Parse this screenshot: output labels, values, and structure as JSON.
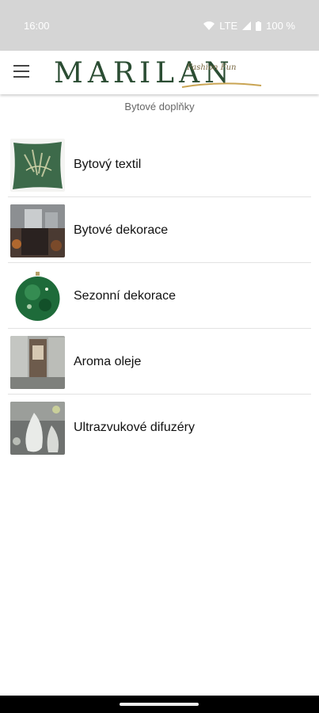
{
  "status": {
    "time": "16:00",
    "network": "LTE",
    "battery": "100 %"
  },
  "header": {
    "logo_main": "MARILAN",
    "logo_script": "Fashion Fun"
  },
  "page_title": "Bytové doplňky",
  "categories": [
    {
      "label": "Bytový textil",
      "icon": "pillow-thumbnail"
    },
    {
      "label": "Bytové dekorace",
      "icon": "decor-thumbnail"
    },
    {
      "label": "Sezonní dekorace",
      "icon": "ornament-thumbnail"
    },
    {
      "label": "Aroma oleje",
      "icon": "aroma-oil-thumbnail"
    },
    {
      "label": "Ultrazvukové difuzéry",
      "icon": "diffuser-thumbnail"
    }
  ],
  "colors": {
    "brand_green": "#2b4d33",
    "status_bar": "#d5d5d5"
  }
}
